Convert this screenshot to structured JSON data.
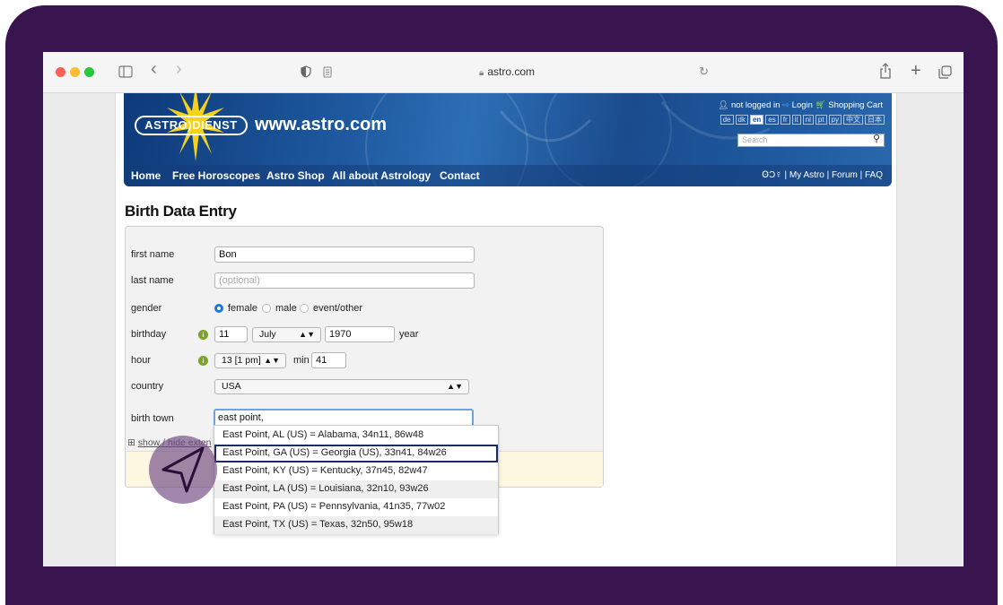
{
  "browser": {
    "url": "astro.com",
    "buttons": {
      "back": "‹",
      "forward": "›"
    }
  },
  "site": {
    "logo_text": "ASTRO)DIENST",
    "title": "www.astro.com",
    "account": {
      "status": "not logged in",
      "login": "Login",
      "cart": "Shopping Cart"
    },
    "languages": [
      "de",
      "dk",
      "en",
      "es",
      "fr",
      "it",
      "nl",
      "pt",
      "py",
      "中文",
      "日本"
    ],
    "active_language": "en",
    "search_placeholder": "Search",
    "nav": [
      "Home",
      "Free Horoscopes",
      "Astro Shop",
      "All about Astrology",
      "Contact"
    ],
    "nav_right": "ꙨϽ☿ | My Astro | Forum | FAQ"
  },
  "form": {
    "heading": "Birth Data Entry",
    "labels": {
      "first_name": "first name",
      "last_name": "last name",
      "gender": "gender",
      "birthday": "birthday",
      "hour": "hour",
      "country": "country",
      "birth_town": "birth town"
    },
    "first_name": "Bon",
    "last_name_placeholder": "(optional)",
    "gender_options": [
      "female",
      "male",
      "event/other"
    ],
    "gender_selected": "female",
    "birth_day": "11",
    "birth_month": "July",
    "birth_year": "1970",
    "year_label": "year",
    "hour": "13 [1 pm]",
    "min_label": "min",
    "minute": "41",
    "country": "USA",
    "birth_town": "east point,",
    "show_hide": "show / hide exten"
  },
  "suggestions": [
    "East Point, AL (US) = Alabama, 34n11, 86w48",
    "East Point, GA (US) = Georgia (US), 33n41, 84w26",
    "East Point, KY (US) = Kentucky, 37n45, 82w47",
    "East Point, LA (US) = Louisiana, 32n10, 93w26",
    "East Point, PA (US) = Pennsylvania, 41n35, 77w02",
    "East Point, TX (US) = Texas, 32n50, 95w18"
  ],
  "highlighted_suggestion": 1,
  "colors": {
    "frame": "#391550",
    "banner": "#1f5aa0",
    "radio_on": "#1a7ae0",
    "info_icon": "#7aa428"
  }
}
